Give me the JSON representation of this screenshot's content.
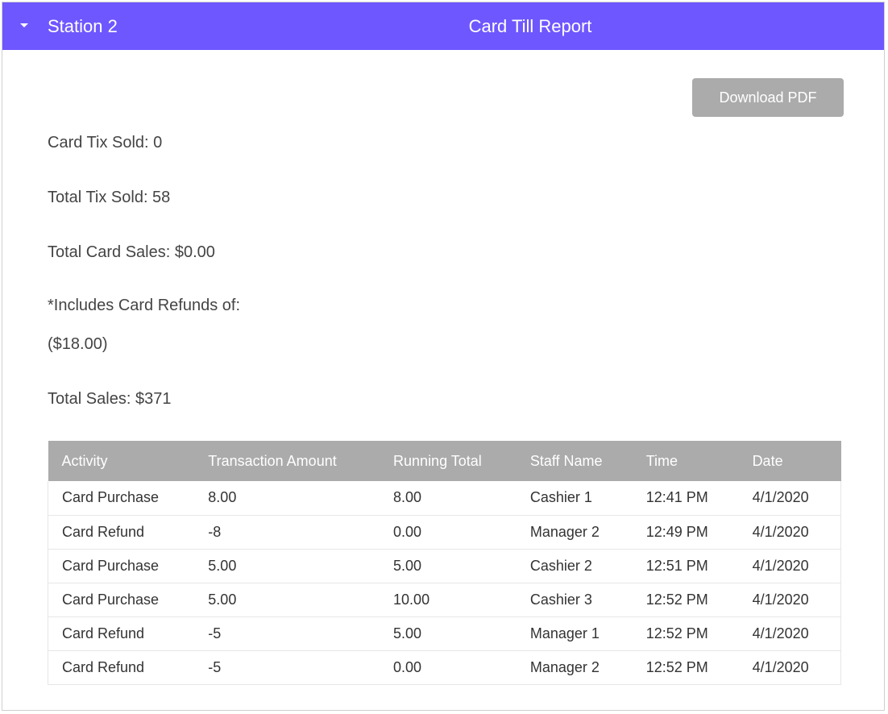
{
  "header": {
    "station": "Station 2",
    "title": "Card Till Report",
    "background_color": "#6e57ff"
  },
  "actions": {
    "download_label": "Download PDF"
  },
  "stats": {
    "card_tix_sold": "Card Tix Sold: 0",
    "total_tix_sold": "Total Tix Sold: 58",
    "total_card_sales": "Total Card Sales: $0.00",
    "refunds_note": "*Includes Card Refunds of:",
    "refunds_amount": "($18.00)",
    "total_sales": "Total Sales: $371"
  },
  "table": {
    "columns": [
      "Activity",
      "Transaction Amount",
      "Running Total",
      "Staff Name",
      "Time",
      "Date"
    ],
    "rows": [
      [
        "Card Purchase",
        "8.00",
        "8.00",
        "Cashier 1",
        "12:41 PM",
        "4/1/2020"
      ],
      [
        "Card Refund",
        "-8",
        "0.00",
        "Manager 2",
        "12:49 PM",
        "4/1/2020"
      ],
      [
        "Card Purchase",
        "5.00",
        "5.00",
        "Cashier 2",
        "12:51 PM",
        "4/1/2020"
      ],
      [
        "Card Purchase",
        "5.00",
        "10.00",
        "Cashier 3",
        "12:52 PM",
        "4/1/2020"
      ],
      [
        "Card Refund",
        "-5",
        "5.00",
        "Manager 1",
        "12:52 PM",
        "4/1/2020"
      ],
      [
        "Card Refund",
        "-5",
        "0.00",
        "Manager 2",
        "12:52 PM",
        "4/1/2020"
      ]
    ]
  }
}
